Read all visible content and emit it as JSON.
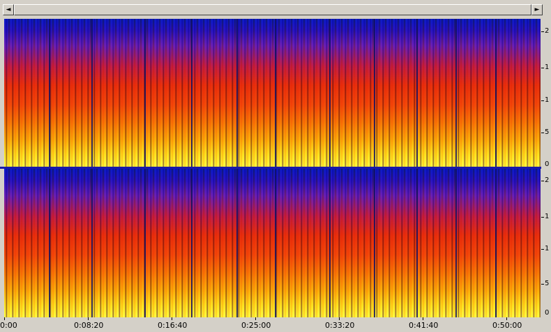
{
  "scrollbar": {
    "left_arrow": "◄",
    "right_arrow": "►"
  },
  "freq_labels_top": [
    "2",
    "1",
    "1",
    "5",
    "0"
  ],
  "freq_labels_bottom": [
    "2",
    "1",
    "1",
    "5",
    "0"
  ],
  "time_labels": [
    "0:00",
    "0:08:20",
    "0:16:40",
    "0:25:00",
    "0:33:20",
    "0:41:40",
    "0:50:00"
  ],
  "colors": {
    "low": "#0b1bc8",
    "mid": "#e8300d",
    "high": "#ffff40",
    "chrome": "#d4d0c8"
  }
}
